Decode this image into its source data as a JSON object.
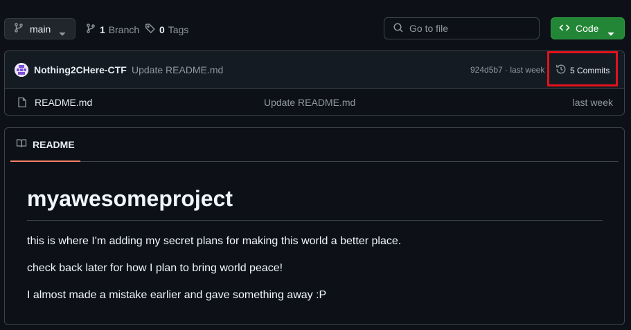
{
  "branch": {
    "name": "main"
  },
  "meta": {
    "branch_count": "1",
    "branch_label": "Branch",
    "tag_count": "0",
    "tags_label": "Tags"
  },
  "search": {
    "placeholder": "Go to file"
  },
  "code_button": {
    "label": "Code"
  },
  "commit": {
    "author": "Nothing2CHere-CTF",
    "message": "Update README.md",
    "hash": "924d5b7",
    "separator": " · ",
    "age": "last week",
    "commits_label": "5 Commits"
  },
  "files": [
    {
      "name": "README.md",
      "message": "Update README.md",
      "age": "last week"
    }
  ],
  "readme": {
    "tab_label": "README",
    "heading": "myawesomeproject",
    "paragraphs": [
      "this is where I'm adding my secret plans for making this world a better place.",
      "check back later for how I plan to bring world peace!",
      "I almost made a mistake earlier and gave something away :P"
    ]
  },
  "colors": {
    "background": "#0d1117",
    "accent_green": "#238636",
    "tab_underline": "#f78166",
    "highlight_box": "#e3121c"
  },
  "icons": {
    "branch": "git-branch-icon",
    "tag": "tag-icon",
    "search": "search-icon",
    "code": "code-icon",
    "history": "history-icon",
    "file": "file-icon",
    "book": "book-icon"
  }
}
